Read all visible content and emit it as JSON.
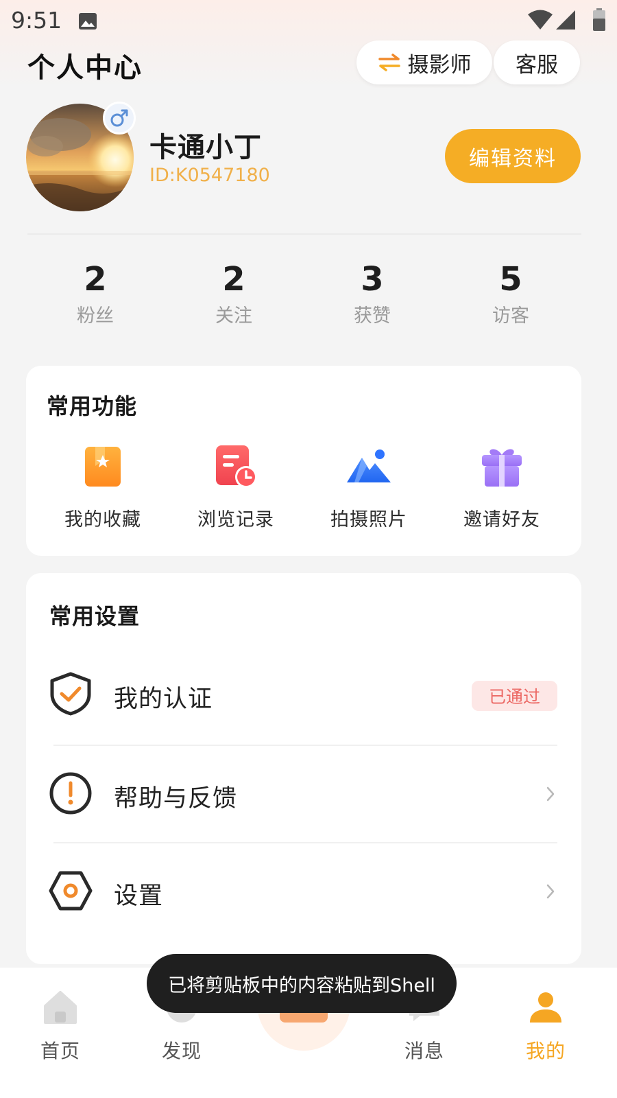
{
  "status_bar": {
    "time": "9:51"
  },
  "header": {
    "title": "个人中心",
    "switch_button": "摄影师",
    "service_button": "客服"
  },
  "profile": {
    "name": "卡通小丁",
    "id": "ID:K0547180",
    "gender": "male",
    "edit_button": "编辑资料"
  },
  "stats": [
    {
      "value": "2",
      "label": "粉丝"
    },
    {
      "value": "2",
      "label": "关注"
    },
    {
      "value": "3",
      "label": "获赞"
    },
    {
      "value": "5",
      "label": "访客"
    }
  ],
  "functions": {
    "title": "常用功能",
    "items": [
      {
        "label": "我的收藏",
        "icon": "bookmark-star-icon"
      },
      {
        "label": "浏览记录",
        "icon": "history-doc-icon"
      },
      {
        "label": "拍摄照片",
        "icon": "mountain-photo-icon"
      },
      {
        "label": "邀请好友",
        "icon": "gift-icon"
      }
    ]
  },
  "settings": {
    "title": "常用设置",
    "items": [
      {
        "label": "我的认证",
        "icon": "shield-check-icon",
        "badge": "已通过"
      },
      {
        "label": "帮助与反馈",
        "icon": "help-alert-icon"
      },
      {
        "label": "设置",
        "icon": "settings-hexagon-icon"
      }
    ]
  },
  "bottom_nav": {
    "items": [
      {
        "label": "首页",
        "icon": "home-icon"
      },
      {
        "label": "发现",
        "icon": "discover-icon"
      },
      {
        "label": "消息",
        "icon": "message-icon"
      },
      {
        "label": "我的",
        "icon": "user-icon",
        "active": true
      }
    ]
  },
  "toast": "已将剪贴板中的内容粘贴到Shell",
  "colors": {
    "accent": "#f5ad25",
    "badge_bg": "#fde7e6",
    "badge_text": "#ec6a66"
  }
}
